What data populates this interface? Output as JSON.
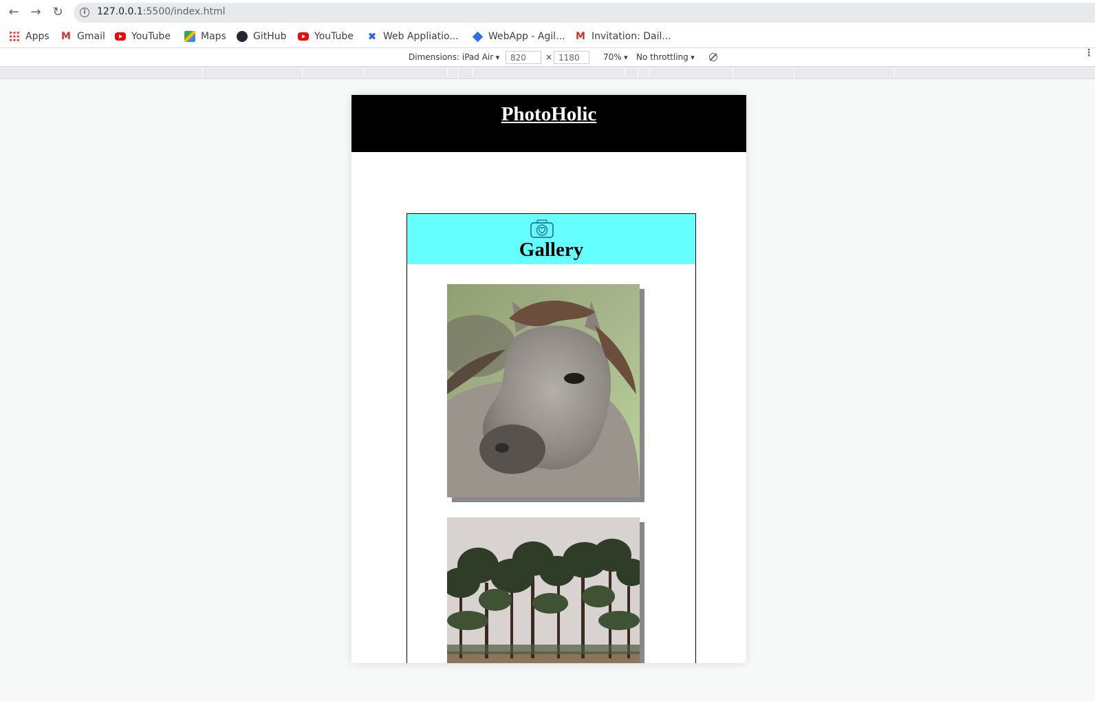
{
  "browser": {
    "url_host": "127.0.0.1",
    "url_rest": ":5500/index.html",
    "bookmarks": [
      {
        "label": "Apps",
        "icon": "apps-grid-icon"
      },
      {
        "label": "Gmail",
        "icon": "gmail-icon"
      },
      {
        "label": "YouTube",
        "icon": "youtube-icon"
      },
      {
        "label": "Maps",
        "icon": "maps-icon"
      },
      {
        "label": "GitHub",
        "icon": "github-icon"
      },
      {
        "label": "YouTube",
        "icon": "youtube-icon"
      },
      {
        "label": "Web Appliatio...",
        "icon": "jira-icon"
      },
      {
        "label": "WebApp - Agil...",
        "icon": "diamond-icon"
      },
      {
        "label": "Invitation: Dail...",
        "icon": "gmail-icon"
      }
    ]
  },
  "device_toolbar": {
    "dimensions_label": "Dimensions: iPad Air",
    "width_value": "820",
    "times": "×",
    "height_value": "1180",
    "zoom": "70%",
    "throttling": "No throttling"
  },
  "page": {
    "site_title": "PhotoHolic",
    "gallery_title": "Gallery",
    "header_bg": "#000000",
    "gallery_head_bg": "#66ffff",
    "photos": [
      {
        "subject": "horse"
      },
      {
        "subject": "pine-forest"
      }
    ]
  }
}
